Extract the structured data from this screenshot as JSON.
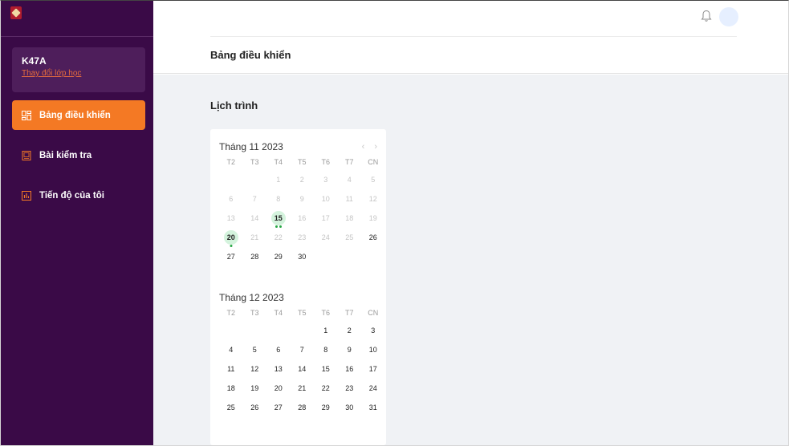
{
  "sidebar": {
    "class_name": "K47A",
    "change_class_label": "Thay đổi lớp học",
    "items": [
      {
        "label": "Bảng điều khiển",
        "icon": "dashboard-icon",
        "active": true
      },
      {
        "label": "Bài kiểm tra",
        "icon": "quiz-icon",
        "active": false
      },
      {
        "label": "Tiến độ của tôi",
        "icon": "progress-chart-icon",
        "active": false
      }
    ]
  },
  "header": {
    "icons": [
      "bell-icon",
      "avatar"
    ]
  },
  "page": {
    "title": "Bảng điều khiển",
    "schedule_title": "Lịch trình"
  },
  "calendar": {
    "weekdays": [
      "T2",
      "T3",
      "T4",
      "T5",
      "T6",
      "T7",
      "CN"
    ],
    "months": [
      {
        "title": "Tháng 11 2023",
        "show_nav": true,
        "days": [
          {
            "d": "",
            "m": false
          },
          {
            "d": "",
            "m": false
          },
          {
            "d": "1",
            "m": true
          },
          {
            "d": "2",
            "m": true
          },
          {
            "d": "3",
            "m": true
          },
          {
            "d": "4",
            "m": true
          },
          {
            "d": "5",
            "m": true
          },
          {
            "d": "6",
            "m": true
          },
          {
            "d": "7",
            "m": true
          },
          {
            "d": "8",
            "m": true
          },
          {
            "d": "9",
            "m": true
          },
          {
            "d": "10",
            "m": true
          },
          {
            "d": "11",
            "m": true
          },
          {
            "d": "12",
            "m": true
          },
          {
            "d": "13",
            "m": true
          },
          {
            "d": "14",
            "m": true
          },
          {
            "d": "15",
            "m": false,
            "mark": true,
            "dots": 2
          },
          {
            "d": "16",
            "m": true
          },
          {
            "d": "17",
            "m": true
          },
          {
            "d": "18",
            "m": true
          },
          {
            "d": "19",
            "m": true
          },
          {
            "d": "20",
            "m": false,
            "mark": true,
            "dots": 1
          },
          {
            "d": "21",
            "m": true
          },
          {
            "d": "22",
            "m": true
          },
          {
            "d": "23",
            "m": true
          },
          {
            "d": "24",
            "m": true
          },
          {
            "d": "25",
            "m": true
          },
          {
            "d": "26",
            "m": false
          },
          {
            "d": "27",
            "m": false
          },
          {
            "d": "28",
            "m": false
          },
          {
            "d": "29",
            "m": false
          },
          {
            "d": "30",
            "m": false
          }
        ]
      },
      {
        "title": "Tháng 12 2023",
        "show_nav": false,
        "days": [
          {
            "d": "",
            "m": false
          },
          {
            "d": "",
            "m": false
          },
          {
            "d": "",
            "m": false
          },
          {
            "d": "",
            "m": false
          },
          {
            "d": "1",
            "m": false
          },
          {
            "d": "2",
            "m": false
          },
          {
            "d": "3",
            "m": false
          },
          {
            "d": "4",
            "m": false
          },
          {
            "d": "5",
            "m": false
          },
          {
            "d": "6",
            "m": false
          },
          {
            "d": "7",
            "m": false
          },
          {
            "d": "8",
            "m": false
          },
          {
            "d": "9",
            "m": false
          },
          {
            "d": "10",
            "m": false
          },
          {
            "d": "11",
            "m": false
          },
          {
            "d": "12",
            "m": false
          },
          {
            "d": "13",
            "m": false
          },
          {
            "d": "14",
            "m": false
          },
          {
            "d": "15",
            "m": false
          },
          {
            "d": "16",
            "m": false
          },
          {
            "d": "17",
            "m": false
          },
          {
            "d": "18",
            "m": false
          },
          {
            "d": "19",
            "m": false
          },
          {
            "d": "20",
            "m": false
          },
          {
            "d": "21",
            "m": false
          },
          {
            "d": "22",
            "m": false
          },
          {
            "d": "23",
            "m": false
          },
          {
            "d": "24",
            "m": false
          },
          {
            "d": "25",
            "m": false
          },
          {
            "d": "26",
            "m": false
          },
          {
            "d": "27",
            "m": false
          },
          {
            "d": "28",
            "m": false
          },
          {
            "d": "29",
            "m": false
          },
          {
            "d": "30",
            "m": false
          },
          {
            "d": "31",
            "m": false
          }
        ]
      }
    ]
  },
  "colors": {
    "sidebar_bg": "#3a0a47",
    "active_item": "#f47924",
    "link": "#e56b3e",
    "event_mark": "#d4f3dd",
    "event_dot": "#28a745"
  }
}
